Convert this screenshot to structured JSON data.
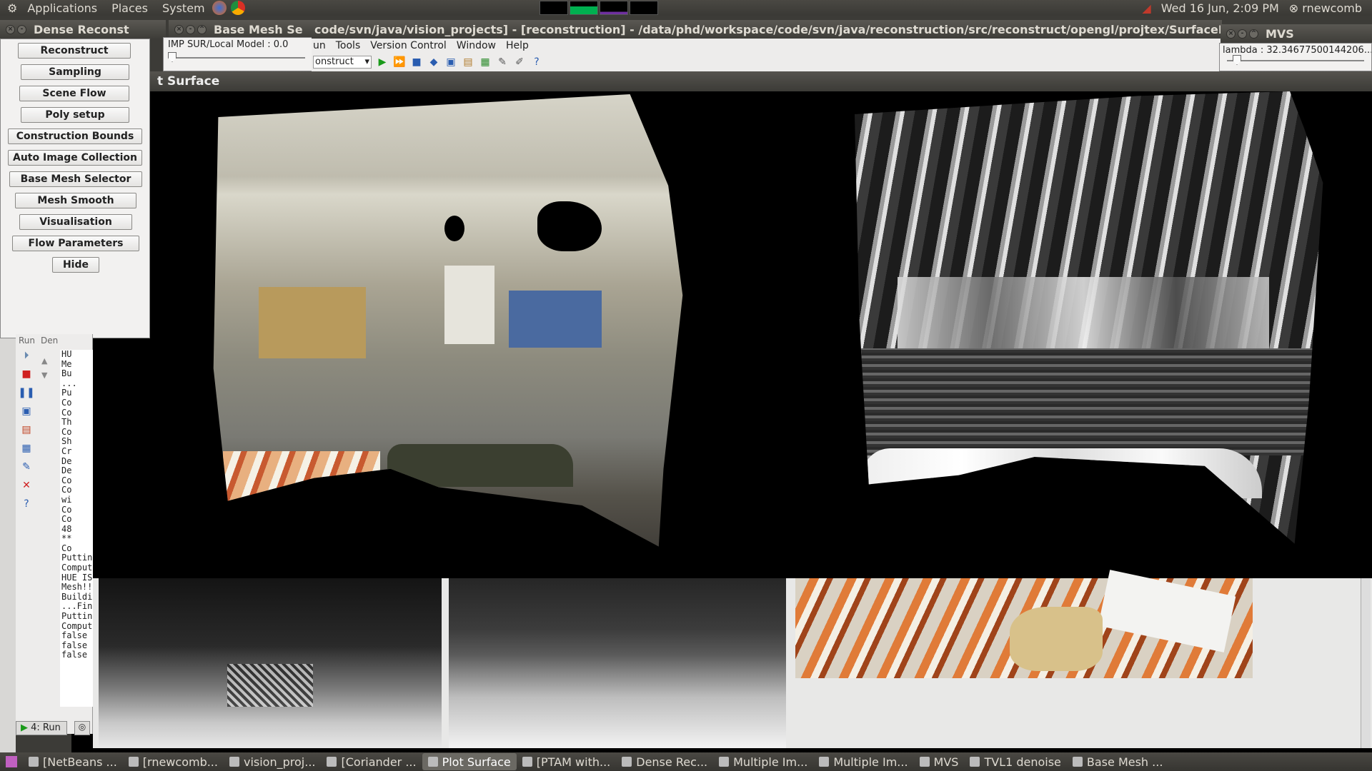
{
  "top_panel": {
    "menus": [
      "Applications",
      "Places",
      "System"
    ],
    "clock": "Wed 16 Jun,  2:09 PM",
    "user": "rnewcomb"
  },
  "plot_window": {
    "title": "t Surface"
  },
  "dense_window": {
    "title": "Dense Reconst",
    "buttons": [
      "Reconstruct",
      "Sampling",
      "Scene Flow",
      "Poly setup",
      "Construction Bounds",
      "Auto Image Collection",
      "Base Mesh Selector",
      "Mesh Smooth",
      "Visualisation",
      "Flow Parameters",
      "Hide"
    ]
  },
  "mesh_window": {
    "title": "Base Mesh Se",
    "slider_label": "IMP SUR/Local Model : 0.0",
    "slider_value": 0.0
  },
  "netbeans": {
    "title": "code/svn/java/vision_projects] - [reconstruction] - /data/phd/workspace/code/svn/java/reconstruction/src/reconstruct/opengl/projtex/SurfaceB",
    "menu": [
      "un",
      "Tools",
      "Version Control",
      "Window",
      "Help"
    ],
    "config_combo": "onstruct"
  },
  "mvs_window": {
    "title": "MVS",
    "lambda_label": "lambda : 32.34677500144206..."
  },
  "run_panel": {
    "header_tabs": [
      "Run",
      "Den"
    ],
    "output_lines": [
      "HU",
      "Me",
      "Bu",
      "...",
      "Pu",
      "Co",
      "Co",
      "Th",
      "Co",
      "Sh",
      "Cr",
      "De",
      "De",
      "Co",
      "Co",
      "wi",
      "Co",
      "Co",
      "48",
      "**",
      "Co",
      "Puttin",
      "Comput",
      "HUE IS",
      "Mesh!!",
      "Buildi",
      "...Fin",
      "Puttin",
      "Comput",
      "false",
      "false",
      "false"
    ],
    "run_tab": "4: Run"
  },
  "taskbar": {
    "items": [
      "[NetBeans ...",
      "[rnewcomb...",
      "vision_proj...",
      "[Coriander ...",
      "Plot Surface",
      "[PTAM with...",
      "Dense Rec...",
      "Multiple Im...",
      "Multiple Im...",
      "MVS",
      "TVL1 denoise",
      "Base Mesh ..."
    ],
    "active": "Plot Surface"
  },
  "colors": {
    "panel_bg": "#3c3b37",
    "window_bg": "#f2f1f0",
    "accent_active": "#6b6963"
  }
}
